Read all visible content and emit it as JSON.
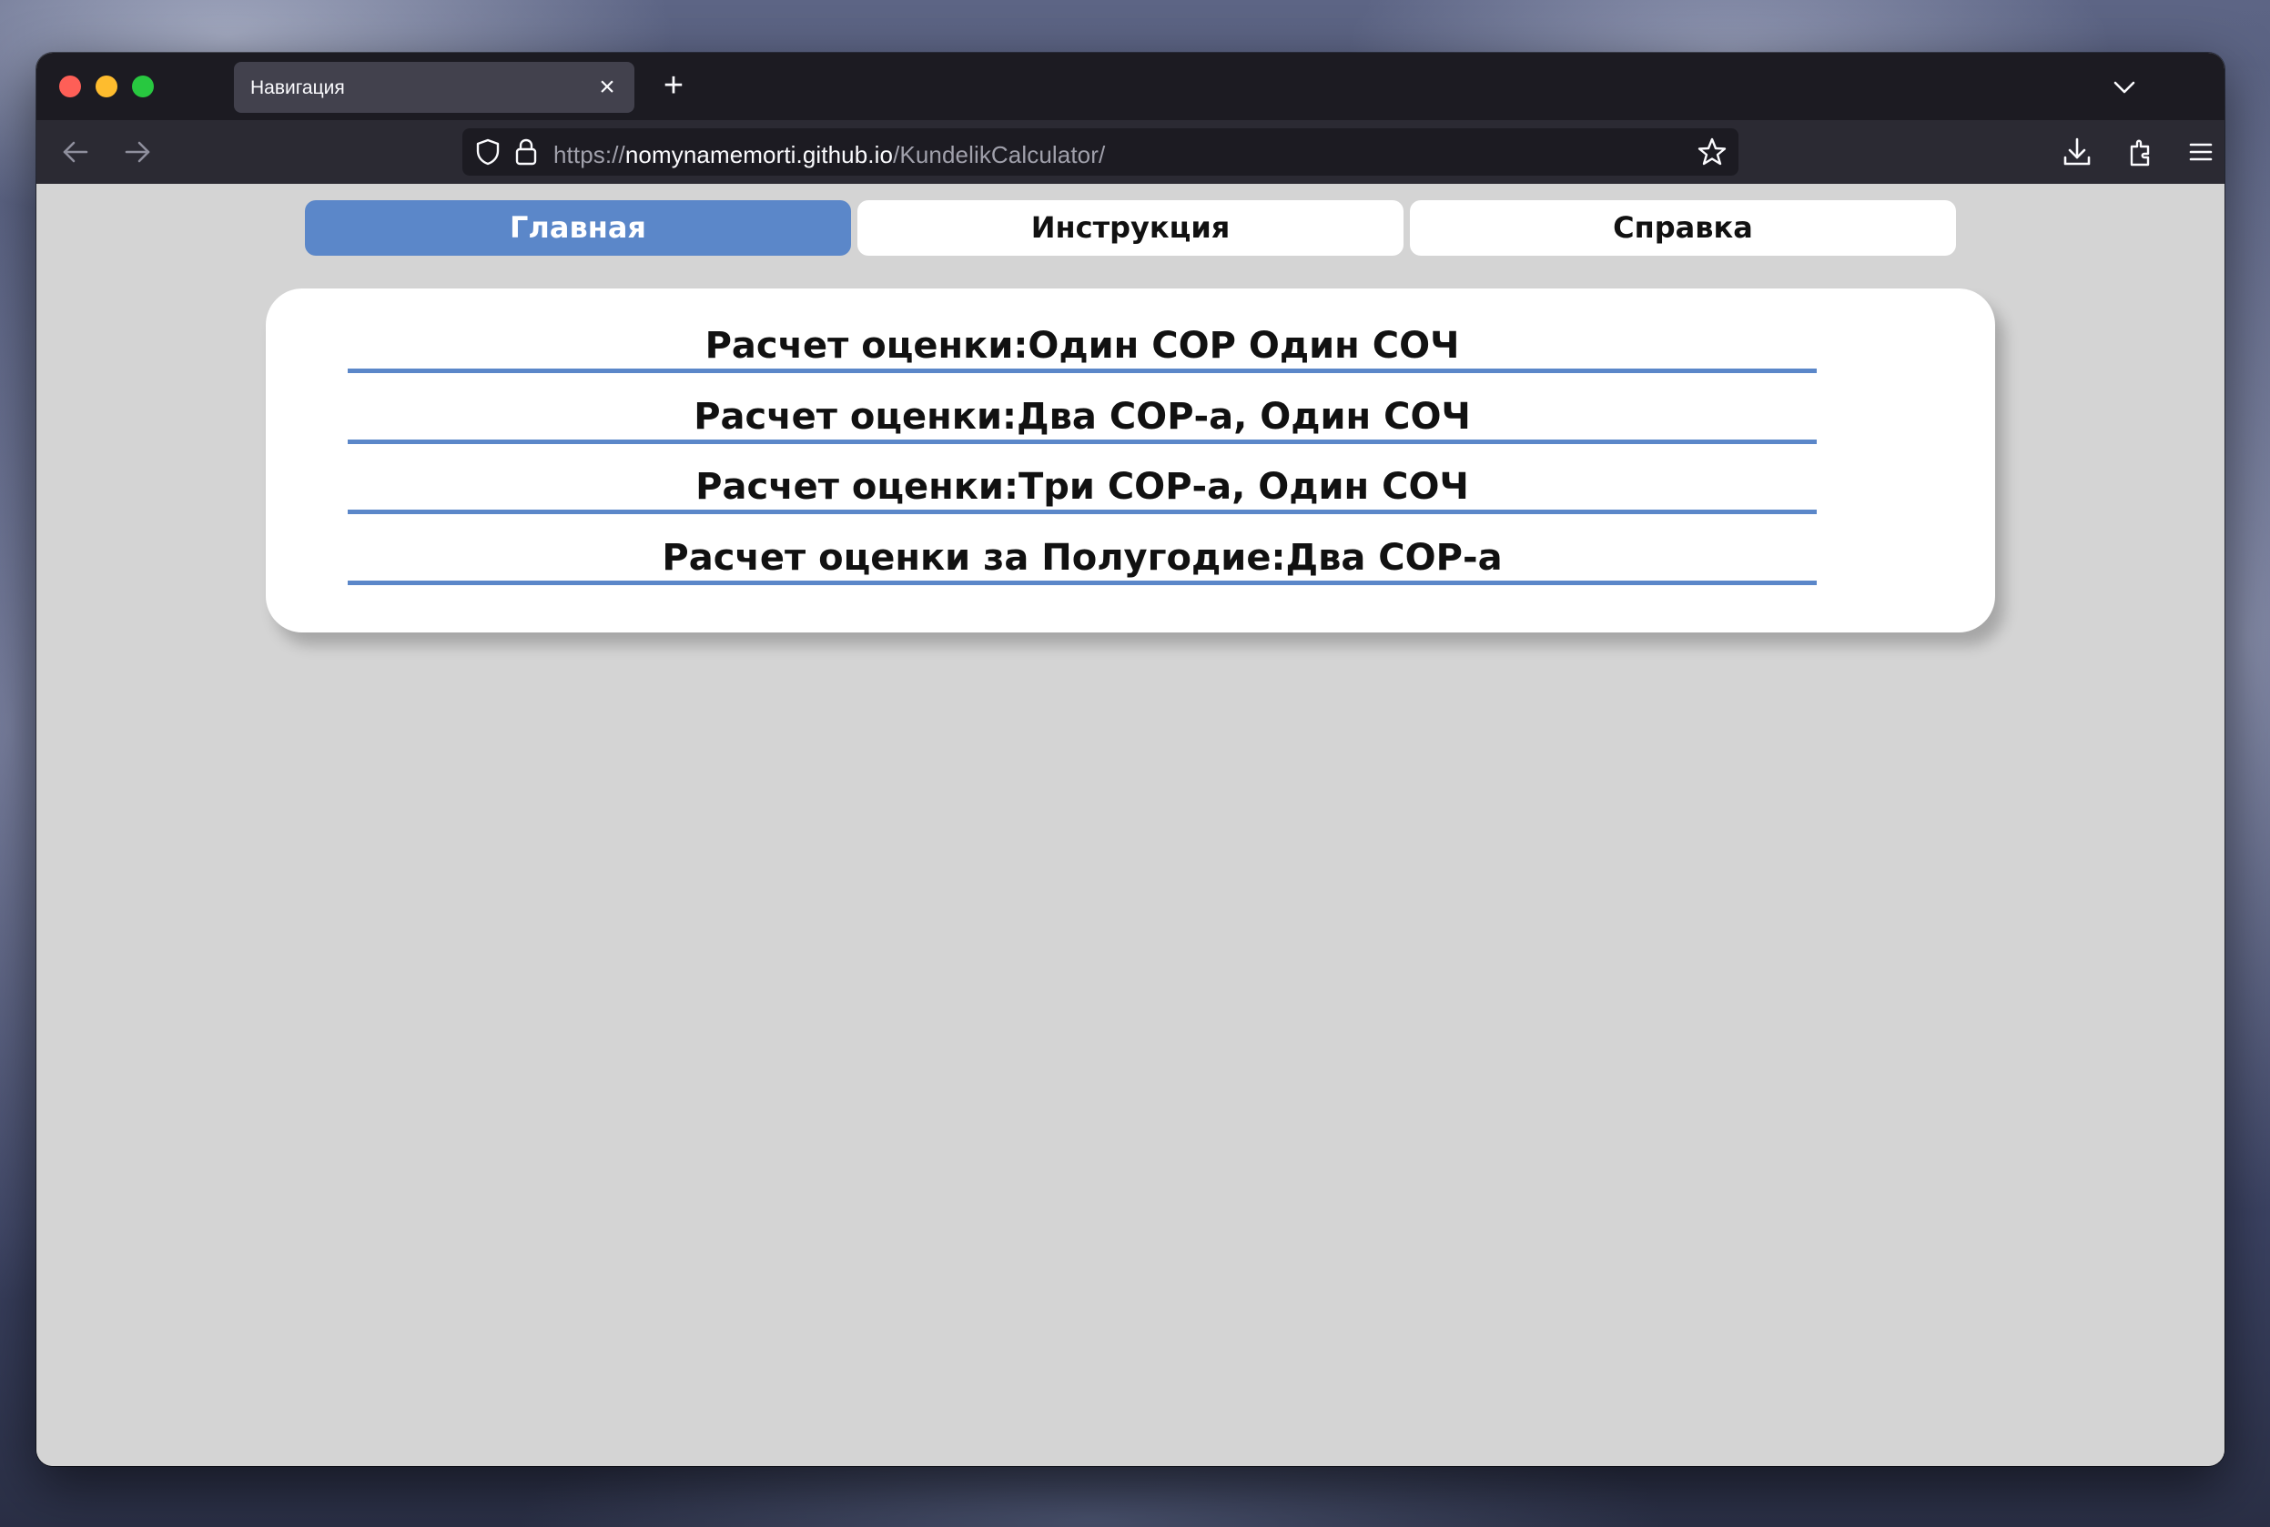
{
  "browser": {
    "tab_title": "Навигация",
    "url_scheme": "https://",
    "url_host": "nomynamemorti.github.io",
    "url_path": "/KundelikCalculator/"
  },
  "nav": {
    "tabs": [
      {
        "label": "Главная",
        "active": true
      },
      {
        "label": "Инструкция",
        "active": false
      },
      {
        "label": "Справка",
        "active": false
      }
    ]
  },
  "menu": {
    "items": [
      "Расчет оценки:Один СОР Один СОЧ",
      "Расчет оценки:Два СОР-а, Один СОЧ",
      "Расчет оценки:Три СОР-а, Один СОЧ",
      "Расчет оценки за Полугодие:Два СОР-а"
    ]
  },
  "colors": {
    "accent": "#5b87c9",
    "page_bg": "#d4d4d4",
    "chrome_dark": "#1c1b22",
    "toolbar": "#2b2a33"
  }
}
